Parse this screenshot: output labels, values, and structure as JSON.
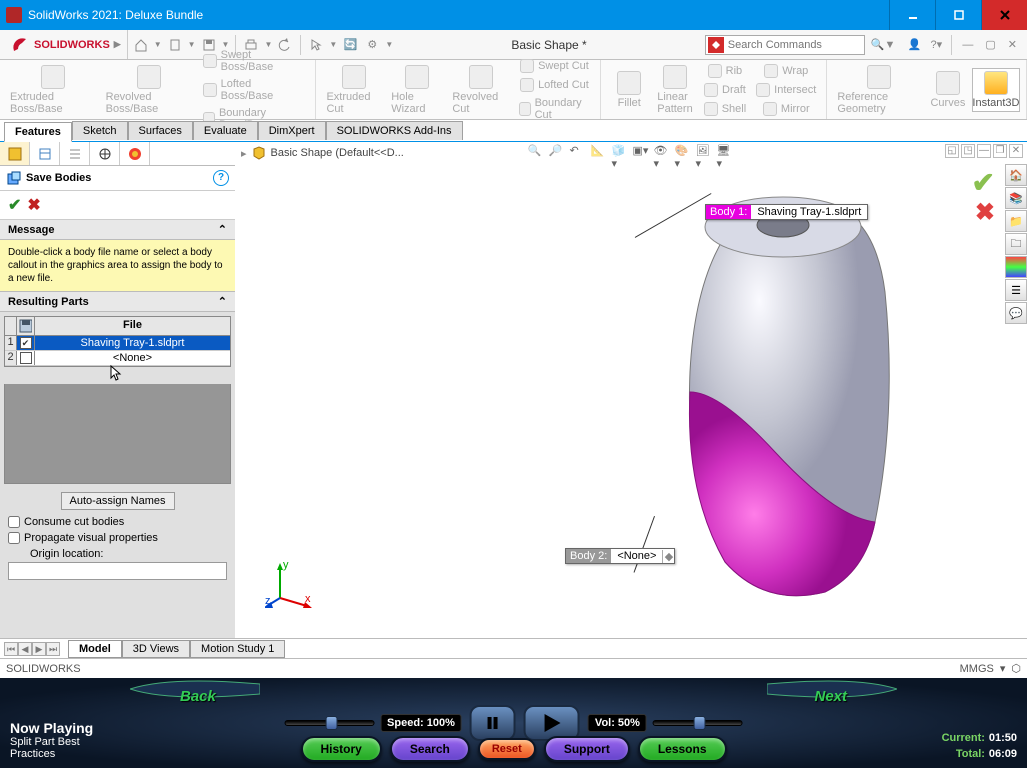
{
  "titlebar": {
    "title": "SolidWorks 2021: Deluxe Bundle"
  },
  "menubar": {
    "doc_name": "Basic Shape *",
    "search_placeholder": "Search Commands"
  },
  "ribbon": {
    "g1": {
      "extruded": "Extruded Boss/Base",
      "revolved": "Revolved Boss/Base",
      "swept": "Swept Boss/Base",
      "lofted": "Lofted Boss/Base",
      "boundary": "Boundary Boss/Base"
    },
    "g2": {
      "extcut": "Extruded Cut",
      "hole": "Hole Wizard",
      "revcut": "Revolved Cut",
      "sweptcut": "Swept Cut",
      "loftcut": "Lofted Cut",
      "boundcut": "Boundary Cut"
    },
    "g3": {
      "fillet": "Fillet",
      "linear": "Linear Pattern",
      "rib": "Rib",
      "draft": "Draft",
      "shell": "Shell",
      "wrap": "Wrap",
      "intersect": "Intersect",
      "mirror": "Mirror"
    },
    "g4": {
      "refgeo": "Reference Geometry",
      "curves": "Curves",
      "instant3d": "Instant3D"
    }
  },
  "tabs": {
    "features": "Features",
    "sketch": "Sketch",
    "surfaces": "Surfaces",
    "evaluate": "Evaluate",
    "dimxpert": "DimXpert",
    "addins": "SOLIDWORKS Add-Ins"
  },
  "breadcrumb": "Basic Shape (Default<<D...",
  "panel": {
    "title": "Save Bodies",
    "msg_head": "Message",
    "msg_body": "Double-click a body file name or select a body callout in the graphics area to assign the body to a new file.",
    "resulting": "Resulting Parts",
    "file_col": "File",
    "row1_num": "1",
    "row1_file": "Shaving Tray-1.sldprt",
    "row2_num": "2",
    "row2_file": "<None>",
    "auto": "Auto-assign Names",
    "consume": "Consume cut bodies",
    "propagate": "Propagate visual properties",
    "origin": "Origin location:"
  },
  "callouts": {
    "c1_label": "Body 1:",
    "c1_value": "Shaving Tray-1.sldprt",
    "c2_label": "Body 2:",
    "c2_value": "<None>"
  },
  "btabs": {
    "model": "Model",
    "views3d": "3D Views",
    "motion": "Motion Study 1"
  },
  "status": {
    "left": "SOLIDWORKS",
    "units": "MMGS"
  },
  "player": {
    "np_title": "Now Playing",
    "np_l1": "Split Part Best",
    "np_l2": "Practices",
    "speed": "Speed: 100%",
    "vol": "Vol: 50%",
    "back": "Back",
    "next": "Next",
    "history": "History",
    "search": "Search",
    "reset": "Reset",
    "support": "Support",
    "lessons": "Lessons",
    "cur_lbl": "Current:",
    "cur_val": "01:50",
    "tot_lbl": "Total:",
    "tot_val": "06:09"
  }
}
